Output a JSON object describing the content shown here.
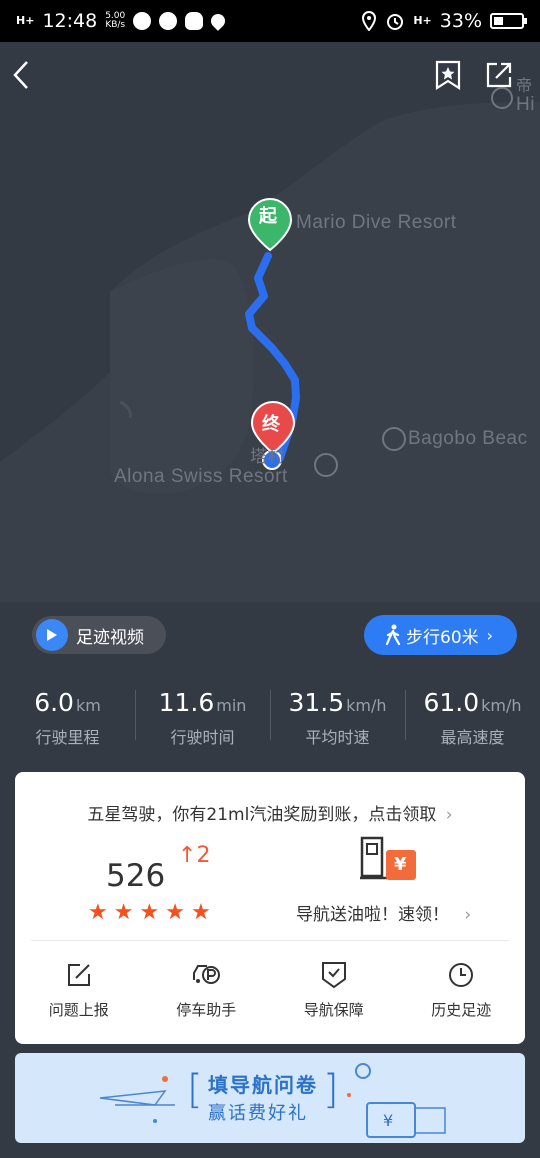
{
  "status_bar": {
    "signal_left": "H+",
    "time": "12:48",
    "net_speed_value": "5.00",
    "net_speed_unit": "KB/s",
    "signal_right": "H+",
    "battery_text": "33%"
  },
  "map": {
    "labels": {
      "mario": "Mario Dive Resort",
      "bagobo": "Bagobo Beac",
      "alona": "Alona Swiss Resort",
      "village": "塔村",
      "top_right_cn": "帝",
      "top_right_en": "Hi"
    },
    "start_marker": "起",
    "end_marker": "终"
  },
  "controls": {
    "footprint_video": "足迹视频",
    "walk_button": "步行60米"
  },
  "stats": [
    {
      "value": "6.0",
      "unit": "km",
      "label": "行驶里程"
    },
    {
      "value": "11.6",
      "unit": "min",
      "label": "行驶时间"
    },
    {
      "value": "31.5",
      "unit": "km/h",
      "label": "平均时速"
    },
    {
      "value": "61.0",
      "unit": "km/h",
      "label": "最高速度"
    }
  ],
  "card": {
    "promo_text": "五星驾驶，你有21ml汽油奖励到账，点击领取",
    "score": "526",
    "score_delta": "2",
    "star_rating": 5,
    "oil_text": "导航送油啦！速领！",
    "oil_icon_char": "¥",
    "tools": [
      {
        "label": "问题上报",
        "icon": "edit-report-icon"
      },
      {
        "label": "停车助手",
        "icon": "parking-car-icon"
      },
      {
        "label": "导航保障",
        "icon": "shield-check-icon"
      },
      {
        "label": "历史足迹",
        "icon": "clock-history-icon"
      }
    ]
  },
  "banner": {
    "title": "填导航问卷",
    "subtitle": "赢话费好礼",
    "ticket_char": "¥"
  }
}
